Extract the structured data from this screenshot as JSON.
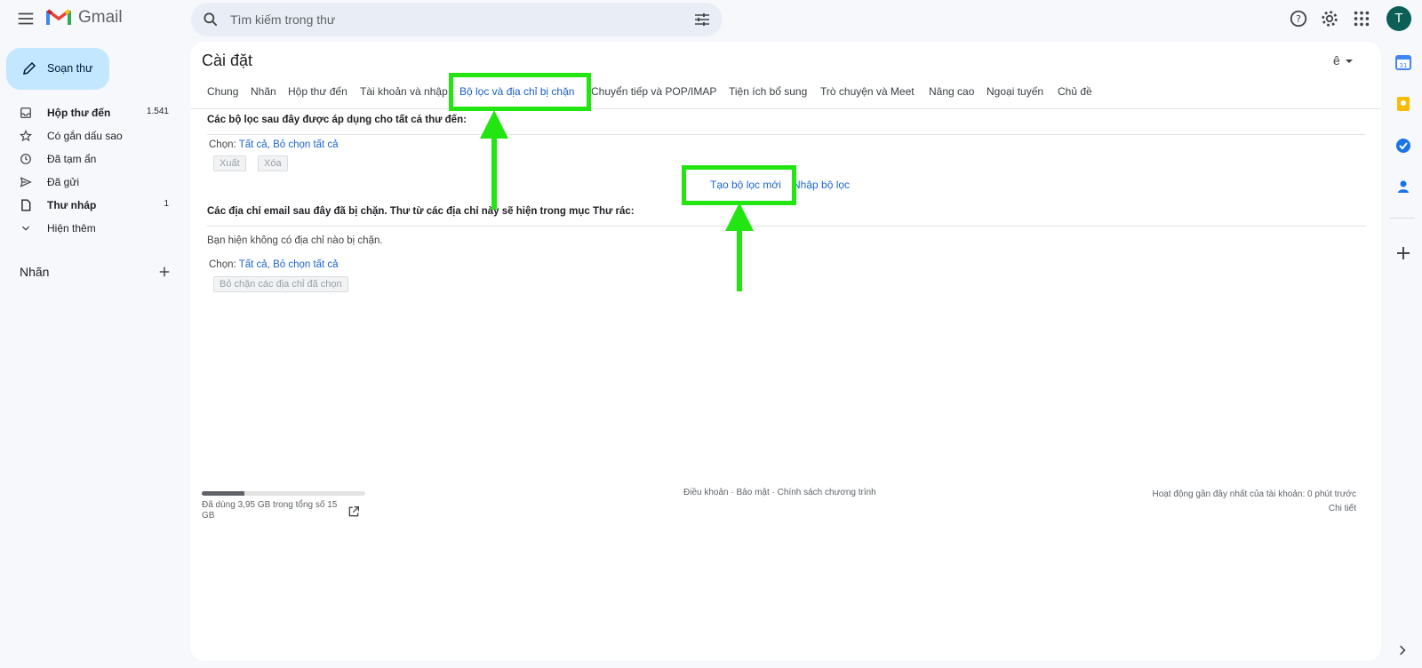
{
  "header": {
    "app_name": "Gmail",
    "search_placeholder": "Tìm kiếm trong thư",
    "avatar_letter": "T"
  },
  "nav": {
    "compose_label": "Soạn thư",
    "items": [
      {
        "label": "Hộp thư đến",
        "count": "1.541",
        "icon": "inbox-icon",
        "bold": true
      },
      {
        "label": "Có gắn dấu sao",
        "count": "",
        "icon": "star-icon",
        "bold": false
      },
      {
        "label": "Đã tạm ẩn",
        "count": "",
        "icon": "clock-icon",
        "bold": false
      },
      {
        "label": "Đã gửi",
        "count": "",
        "icon": "send-icon",
        "bold": false
      },
      {
        "label": "Thư nháp",
        "count": "1",
        "icon": "draft-icon",
        "bold": true
      },
      {
        "label": "Hiện thêm",
        "count": "",
        "icon": "chevron-down-icon",
        "bold": false
      }
    ],
    "labels_heading": "Nhãn"
  },
  "settings": {
    "title": "Cài đặt",
    "language_short": "ê",
    "tabs": [
      "Chung",
      "Nhãn",
      "Hộp thư đến",
      "Tài khoản và nhập",
      "Bộ lọc và địa chỉ bị chặn",
      "Chuyển tiếp và POP/IMAP",
      "Tiện ích bổ sung",
      "Trò chuyện và Meet",
      "Nâng cao",
      "Ngoại tuyến",
      "Chủ đề"
    ],
    "active_tab": "Bộ lọc và địa chỉ bị chặn",
    "filters": {
      "heading": "Các bộ lọc sau đây được áp dụng cho tất cả thư đến:",
      "select_prefix": "Chọn:",
      "select_all": "Tất cả",
      "select_none": "Bỏ chọn tất cả",
      "export_label": "Xuất",
      "delete_label": "Xóa",
      "create_filter": "Tạo bộ lọc mới",
      "import_filter": "Nhập bộ lọc"
    },
    "blocked": {
      "heading": "Các địa chỉ email sau đây đã bị chặn. Thư từ các địa chỉ này sẽ hiện trong mục Thư rác:",
      "empty_text": "Bạn hiện không có địa chỉ nào bị chặn.",
      "select_prefix": "Chọn:",
      "select_all": "Tất cả",
      "select_none": "Bỏ chọn tất cả",
      "unblock_label": "Bỏ chặn các địa chỉ đã chọn"
    }
  },
  "footer": {
    "storage_text": "Đã dùng 3,95 GB trong tổng số 15 GB",
    "storage_used_fraction": 0.26,
    "terms": "Điều khoản",
    "privacy": "Bảo mật",
    "program_policy": "Chính sách chương trình",
    "separator": "·",
    "last_activity": "Hoạt động gần đây nhất của tài khoản: 0 phút trước",
    "details": "Chi tiết"
  },
  "colors": {
    "accent": "#1a66d2",
    "compose_bg": "#c2e7ff",
    "annotation": "#22e512",
    "avatar_bg": "#0b5f57"
  }
}
